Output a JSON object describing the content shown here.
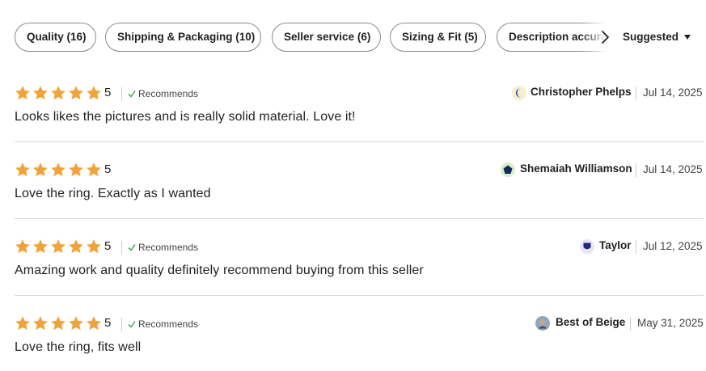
{
  "filters": {
    "chips": [
      {
        "label": "Quality (16)"
      },
      {
        "label": "Shipping & Packaging (10)"
      },
      {
        "label": "Seller service (6)"
      },
      {
        "label": "Sizing & Fit (5)"
      },
      {
        "label": "Description accuracy"
      }
    ],
    "scroll_icon": "chevron-right-icon",
    "sort_label": "Suggested",
    "sort_icon": "caret-down-icon"
  },
  "colors": {
    "star": "#f1a33b",
    "divider": "#d8d8d8",
    "check": "#2e9c4a"
  },
  "reviews": [
    {
      "rating": 5,
      "rating_label": "5",
      "recommends": "Recommends",
      "text": "Looks likes the pictures and is really solid material. Love it!",
      "reviewer": "Christopher Phelps",
      "date": "Jul 14, 2025",
      "avatar_icon": "moon-avatar-icon"
    },
    {
      "rating": 5,
      "rating_label": "5",
      "recommends": "",
      "text": "Love the ring. Exactly as I wanted",
      "reviewer": "Shemaiah Williamson",
      "date": "Jul 14, 2025",
      "avatar_icon": "pentagon-avatar-icon"
    },
    {
      "rating": 5,
      "rating_label": "5",
      "recommends": "Recommends",
      "text": "Amazing work and quality definitely recommend buying from this seller",
      "reviewer": "Taylor",
      "date": "Jul 12, 2025",
      "avatar_icon": "shield-avatar-icon"
    },
    {
      "rating": 5,
      "rating_label": "5",
      "recommends": "Recommends",
      "text": "Love the ring, fits well",
      "reviewer": "Best of Beige",
      "date": "May 31, 2025",
      "avatar_icon": "photo-avatar-icon"
    }
  ]
}
